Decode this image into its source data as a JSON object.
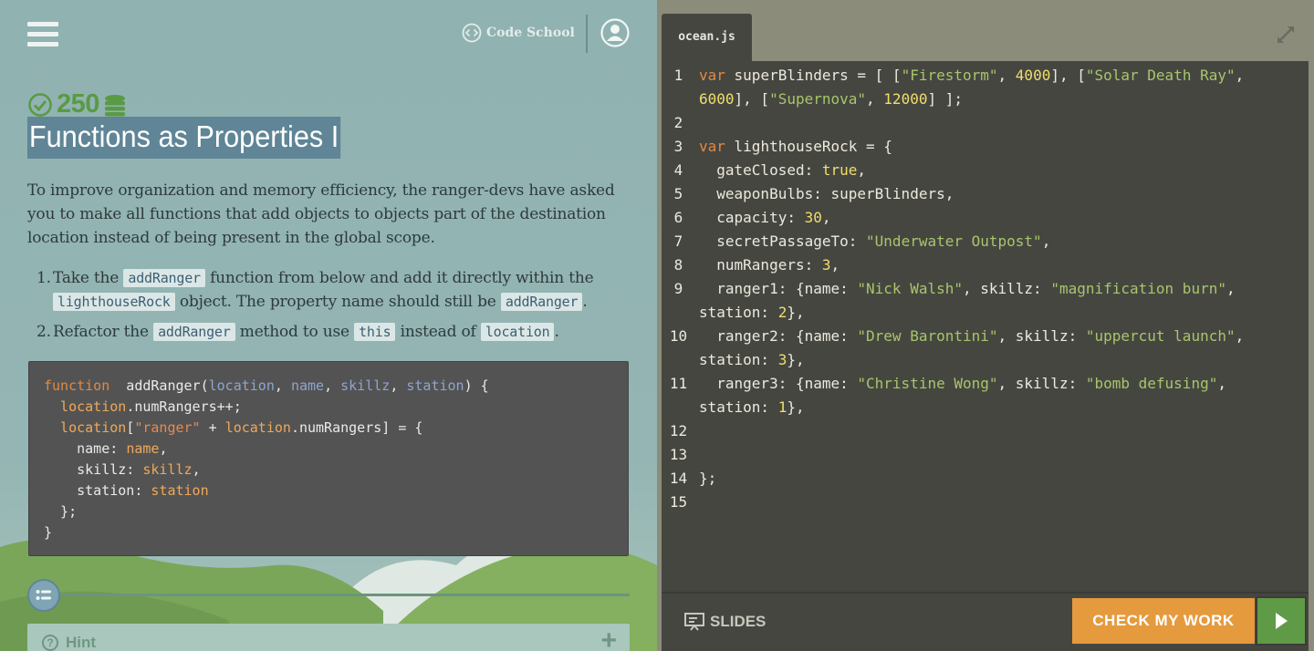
{
  "brand": {
    "name": "Code School"
  },
  "challenge": {
    "points": "250",
    "title": "Functions as Properties I",
    "intro": "To improve organization and memory efficiency, the ranger-devs have asked you to make all functions that add objects to objects part of the destination location instead of being present in the global scope.",
    "tasks": [
      {
        "n": "1.",
        "a": "Take the",
        "c1": "addRanger",
        "b": "function from below and add it directly within the",
        "c2": "lighthouseRock",
        "d": "object. The property name should still be",
        "c3": "addRanger",
        "e": "."
      },
      {
        "n": "2.",
        "a": "Refactor the",
        "c1": "addRanger",
        "b": "method to use",
        "c2": "this",
        "d": "instead of",
        "c3": "location",
        "e": "."
      }
    ],
    "hint_label": "Hint"
  },
  "snippet_lines": [
    [
      [
        "k",
        "function"
      ],
      [
        "",
        "  addRanger("
      ],
      [
        "p",
        "location"
      ],
      [
        "",
        ", "
      ],
      [
        "p",
        "name"
      ],
      [
        "",
        ", "
      ],
      [
        "p",
        "skillz"
      ],
      [
        "",
        ", "
      ],
      [
        "p",
        "station"
      ],
      [
        "",
        ") {"
      ]
    ],
    [
      [
        "o",
        "  location"
      ],
      [
        "",
        ".numRangers++;"
      ]
    ],
    [
      [
        "o",
        "  location"
      ],
      [
        "",
        "["
      ],
      [
        "s",
        "\"ranger\""
      ],
      [
        "",
        " + "
      ],
      [
        "o",
        "location"
      ],
      [
        "",
        ".numRangers] = {"
      ]
    ],
    [
      [
        "",
        "    name: "
      ],
      [
        "o",
        "name"
      ],
      [
        "",
        ","
      ]
    ],
    [
      [
        "",
        "    skillz: "
      ],
      [
        "o",
        "skillz"
      ],
      [
        "",
        ","
      ]
    ],
    [
      [
        "",
        "    station: "
      ],
      [
        "o",
        "station"
      ]
    ],
    [
      [
        "",
        "  };"
      ]
    ],
    [
      [
        "",
        "}"
      ]
    ]
  ],
  "editor": {
    "filename": "ocean.js",
    "lines": [
      {
        "n": "1",
        "t": [
          [
            "ck",
            "var"
          ],
          [
            "",
            " superBlinders = [ ["
          ],
          [
            "cs",
            "\"Firestorm\""
          ],
          [
            "",
            ", "
          ],
          [
            "cn",
            "4000"
          ],
          [
            "",
            "], ["
          ],
          [
            "cs",
            "\"Solar Death Ray\""
          ],
          [
            "",
            ", "
          ],
          [
            "cn",
            "6000"
          ],
          [
            "",
            "], ["
          ],
          [
            "cs",
            "\"Supernova\""
          ],
          [
            "",
            ", "
          ],
          [
            "cn",
            "12000"
          ],
          [
            "",
            "] ];"
          ]
        ]
      },
      {
        "n": "2",
        "t": []
      },
      {
        "n": "3",
        "t": [
          [
            "ck",
            "var"
          ],
          [
            "",
            " lighthouseRock = {"
          ]
        ]
      },
      {
        "n": "4",
        "t": [
          [
            "",
            "  gateClosed: "
          ],
          [
            "cn",
            "true"
          ],
          [
            "",
            ","
          ]
        ]
      },
      {
        "n": "5",
        "t": [
          [
            "",
            "  weaponBulbs: superBlinders,"
          ]
        ]
      },
      {
        "n": "6",
        "t": [
          [
            "",
            "  capacity: "
          ],
          [
            "cn",
            "30"
          ],
          [
            "",
            ","
          ]
        ]
      },
      {
        "n": "7",
        "t": [
          [
            "",
            "  secretPassageTo: "
          ],
          [
            "cs",
            "\"Underwater Outpost\""
          ],
          [
            "",
            ","
          ]
        ]
      },
      {
        "n": "8",
        "t": [
          [
            "",
            "  numRangers: "
          ],
          [
            "cn",
            "3"
          ],
          [
            "",
            ","
          ]
        ]
      },
      {
        "n": "9",
        "t": [
          [
            "",
            "  ranger1: {name: "
          ],
          [
            "cs",
            "\"Nick Walsh\""
          ],
          [
            "",
            ", skillz: "
          ],
          [
            "cs",
            "\"magnification burn\""
          ],
          [
            "",
            ", station: "
          ],
          [
            "cn",
            "2"
          ],
          [
            "",
            "},"
          ]
        ]
      },
      {
        "n": "10",
        "t": [
          [
            "",
            "  ranger2: {name: "
          ],
          [
            "cs",
            "\"Drew Barontini\""
          ],
          [
            "",
            ", skillz: "
          ],
          [
            "cs",
            "\"uppercut launch\""
          ],
          [
            "",
            ", station: "
          ],
          [
            "cn",
            "3"
          ],
          [
            "",
            "},"
          ]
        ]
      },
      {
        "n": "11",
        "t": [
          [
            "",
            "  ranger3: {name: "
          ],
          [
            "cs",
            "\"Christine Wong\""
          ],
          [
            "",
            ", skillz: "
          ],
          [
            "cs",
            "\"bomb defusing\""
          ],
          [
            "",
            ", station: "
          ],
          [
            "cn",
            "1"
          ],
          [
            "",
            "},"
          ]
        ]
      },
      {
        "n": "12",
        "t": []
      },
      {
        "n": "13",
        "t": []
      },
      {
        "n": "14",
        "t": [
          [
            "",
            "};"
          ]
        ]
      },
      {
        "n": "15",
        "t": []
      }
    ]
  },
  "footer": {
    "slides_label": "SLIDES",
    "check_label": "CHECK MY WORK"
  },
  "colors": {
    "accent_orange": "#e59a3e",
    "run_green": "#5f9a47",
    "score_green": "#5a9a44"
  },
  "icons": [
    "menu-icon",
    "code-school-logo-icon",
    "user-avatar-icon",
    "check-circle-icon",
    "coins-icon",
    "expand-icon",
    "slides-icon",
    "play-icon",
    "list-icon",
    "question-icon",
    "plus-icon"
  ]
}
